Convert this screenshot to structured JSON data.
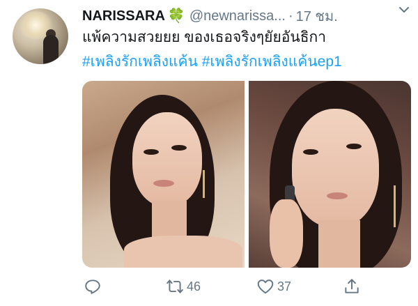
{
  "author": {
    "name": "NARISSARA",
    "emoji": "🍀",
    "handle": "@newnarissa...",
    "separator": "·",
    "time": "17 ชม."
  },
  "tweet": {
    "text": "แพ้ความสวยยย ของเธอจริงๆยัยอันธิกา",
    "hashtags": [
      "#เพลิงรักเพลิงแค้น",
      "#เพลิงรักเพลิงแค้นep1"
    ]
  },
  "actions": {
    "retweets": "46",
    "likes": "37"
  },
  "icons": {
    "menu": "chevron-down-icon",
    "reply": "reply-icon",
    "retweet": "retweet-icon",
    "like": "heart-icon",
    "share": "share-icon"
  },
  "colors": {
    "link": "#1da1f2",
    "muted": "#657786",
    "text": "#14171a",
    "clover": "#3aa53a"
  }
}
